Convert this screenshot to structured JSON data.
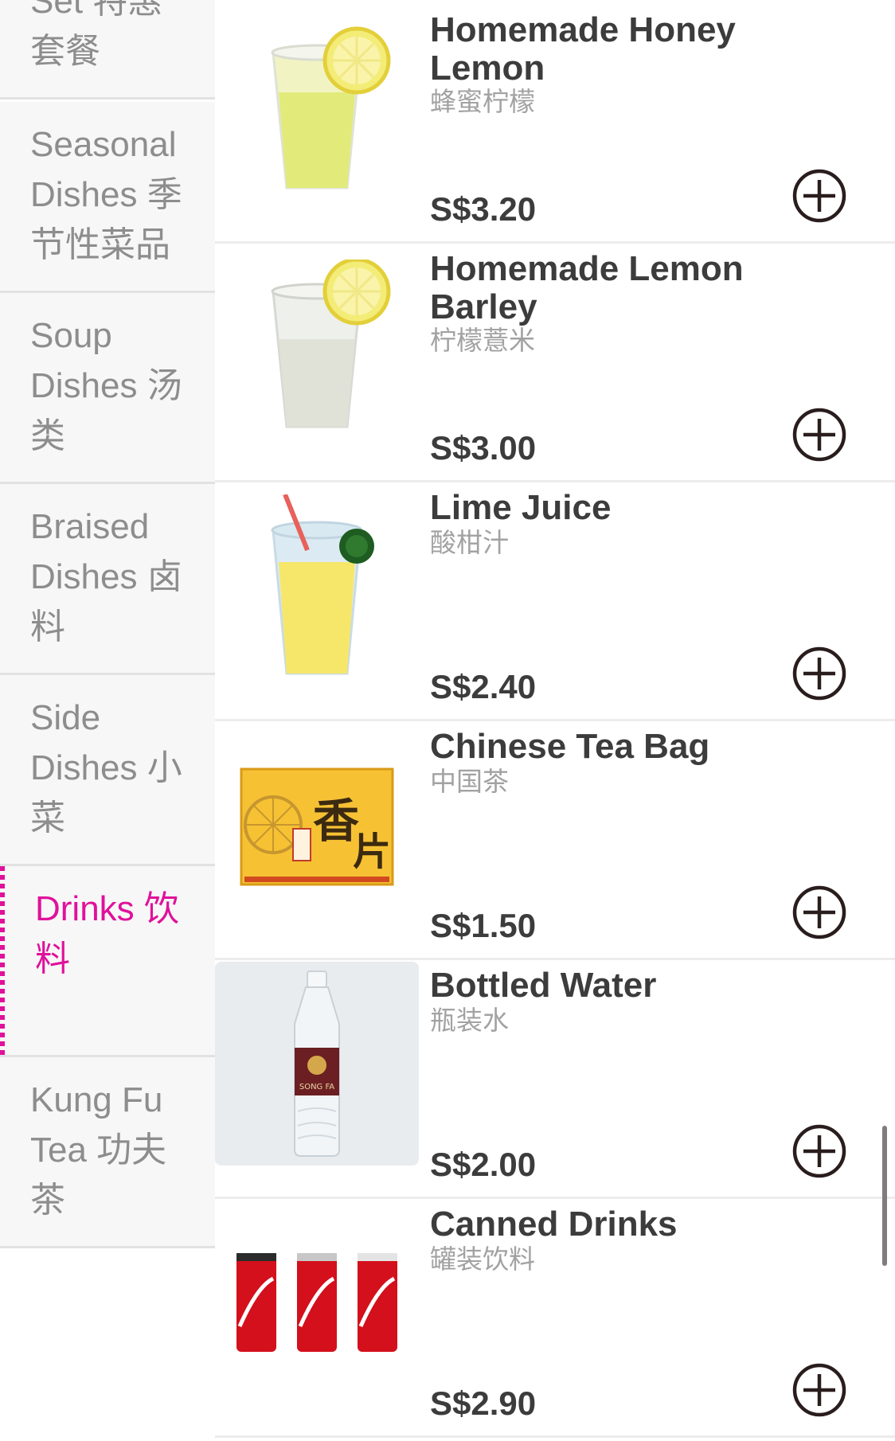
{
  "sidebar": {
    "categories": [
      {
        "label": "Lunch Set 特惠套餐",
        "active": false
      },
      {
        "label": "Seasonal Dishes 季节性菜品",
        "active": false
      },
      {
        "label": "Soup Dishes 汤类",
        "active": false
      },
      {
        "label": "Braised Dishes 卤料",
        "active": false
      },
      {
        "label": "Side Dishes 小菜",
        "active": false
      },
      {
        "label": "Drinks 饮料",
        "active": true
      },
      {
        "label": "Kung Fu Tea 功夫茶",
        "active": false
      }
    ]
  },
  "items": [
    {
      "name": "Homemade Honey Lemon",
      "subtitle": "蜂蜜柠檬",
      "price": "S$3.20",
      "image": "honey-lemon-cup"
    },
    {
      "name": "Homemade Lemon Barley",
      "subtitle": "柠檬薏米",
      "price": "S$3.00",
      "image": "lemon-barley-cup"
    },
    {
      "name": "Lime Juice",
      "subtitle": "酸柑汁",
      "price": "S$2.40",
      "image": "lime-juice-cup"
    },
    {
      "name": "Chinese Tea Bag",
      "subtitle": "中国茶",
      "price": "S$1.50",
      "image": "tea-box"
    },
    {
      "name": "Bottled Water",
      "subtitle": "瓶装水",
      "price": "S$2.00",
      "image": "water-bottle"
    },
    {
      "name": "Canned Drinks",
      "subtitle": "罐装饮料",
      "price": "S$2.90",
      "image": "cola-cans"
    }
  ],
  "icons": {
    "add": "plus-circle-icon"
  },
  "colors": {
    "accent": "#e0119b",
    "text": "#3c3c3c",
    "muted": "#8d8d8d"
  }
}
